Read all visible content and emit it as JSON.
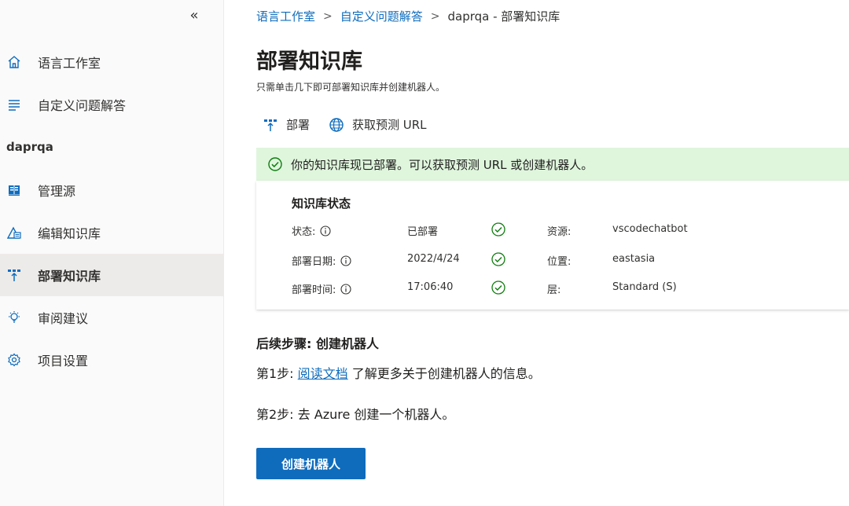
{
  "sidebar": {
    "collapse_glyph": "«",
    "items": [
      {
        "label": "语言工作室",
        "icon": "home-icon"
      },
      {
        "label": "自定义问题解答",
        "icon": "list-icon"
      },
      {
        "label": "管理源",
        "icon": "book-icon"
      },
      {
        "label": "编辑知识库",
        "icon": "edit-kb-icon"
      },
      {
        "label": "部署知识库",
        "icon": "deploy-icon"
      },
      {
        "label": "审阅建议",
        "icon": "lightbulb-icon"
      },
      {
        "label": "项目设置",
        "icon": "gear-icon"
      }
    ],
    "project_name": "daprqa",
    "active_index": 4
  },
  "breadcrumb": {
    "items": [
      "语言工作室",
      "自定义问题解答",
      "daprqa - 部署知识库"
    ],
    "separator": ">"
  },
  "page": {
    "title": "部署知识库",
    "subtitle": "只需单击几下即可部署知识库并创建机器人。"
  },
  "toolbar": {
    "deploy_label": "部署",
    "prediction_url_label": "获取预测 URL"
  },
  "banner": {
    "message": "你的知识库现已部署。可以获取预测 URL 或创建机器人。"
  },
  "status_card": {
    "title": "知识库状态",
    "rows": [
      {
        "label": "状态:",
        "value": "已部署",
        "label2": "资源:",
        "value2": "vscodechatbot"
      },
      {
        "label": "部署日期:",
        "value": "2022/4/24",
        "label2": "位置:",
        "value2": "eastasia"
      },
      {
        "label": "部署时间:",
        "value": "17:06:40",
        "label2": "层:",
        "value2": "Standard (S)"
      }
    ]
  },
  "next_steps": {
    "title": "后续步骤: 创建机器人",
    "step1_prefix": "第1步:",
    "step1_link": "阅读文档",
    "step1_suffix": "了解更多关于创建机器人的信息。",
    "step2": "第2步: 去 Azure 创建一个机器人。",
    "create_bot_label": "创建机器人"
  },
  "colors": {
    "accent": "#0f6cbd",
    "success_bg": "#dff6dd",
    "success_icon": "#107c10",
    "sidebar_active": "#edebe9"
  }
}
